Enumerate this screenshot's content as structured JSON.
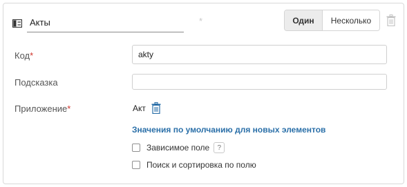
{
  "header": {
    "type_icon": "list-icon",
    "name_value": "Акты",
    "required_mark": "*",
    "mode_options": [
      {
        "label": "Один",
        "selected": true
      },
      {
        "label": "Несколько",
        "selected": false
      }
    ],
    "delete_icon": "trash-icon"
  },
  "fields": {
    "code": {
      "label": "Код",
      "required": "*",
      "value": "akty"
    },
    "hint": {
      "label": "Подсказка",
      "value": ""
    },
    "attachment": {
      "label": "Приложение",
      "required": "*",
      "file_name": "Акт",
      "delete_icon": "trash-icon"
    }
  },
  "defaults": {
    "title": "Значения по умолчанию для новых элементов",
    "dependent": {
      "label": "Зависимое поле",
      "checked": false,
      "help": "?"
    },
    "search_sort": {
      "label": "Поиск и сортировка по полю",
      "checked": false
    }
  },
  "colors": {
    "accent": "#2a6fa8",
    "required": "#d0342c",
    "trash": "#2a6fa8"
  }
}
